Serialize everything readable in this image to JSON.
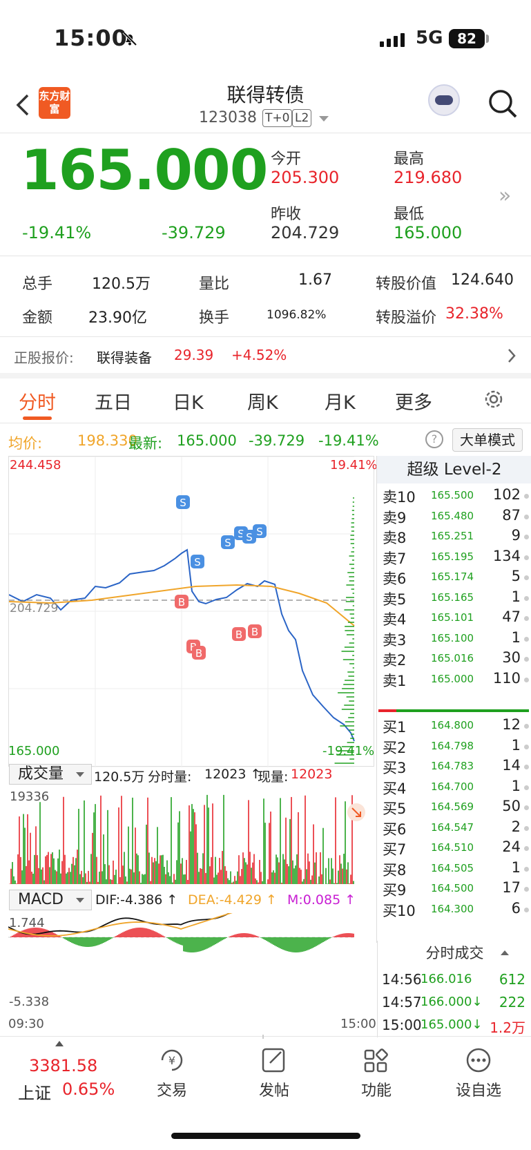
{
  "status_bar": {
    "time": "15:00",
    "network": "5G",
    "battery": "82"
  },
  "header": {
    "logo_text": "东方财富",
    "title": "联得转债",
    "code": "123038",
    "tag1": "T+0",
    "tag2": "L2"
  },
  "quote": {
    "price": "165.000",
    "change_pct": "-19.41%",
    "change": "-39.729",
    "open_label": "今开",
    "open": "205.300",
    "high_label": "最高",
    "high": "219.680",
    "prev_close_label": "昨收",
    "prev_close": "204.729",
    "low_label": "最低",
    "low": "165.000"
  },
  "stats": {
    "vol_label": "总手",
    "vol": "120.5万",
    "ratio_label": "量比",
    "ratio": "1.67",
    "conv_value_label": "转股价值",
    "conv_value": "124.640",
    "amount_label": "金额",
    "amount": "23.90亿",
    "turnover_label": "换手",
    "turnover": "1096.82%",
    "premium_label": "转股溢价",
    "premium": "32.38%"
  },
  "underlying": {
    "label": "正股报价:",
    "name": "联得装备",
    "price": "29.39",
    "change": "+4.52%"
  },
  "tabs": [
    "分时",
    "五日",
    "日K",
    "周K",
    "月K",
    "更多"
  ],
  "info_line": {
    "avg_label": "均价:",
    "avg": "198.330",
    "last_label": "最新:",
    "last": "165.000",
    "chg": "-39.729",
    "pct": "-19.41%",
    "mode_button": "大单模式"
  },
  "chart_labels": {
    "ymax": "244.458",
    "ymin": "165.000",
    "ref": "204.729",
    "pct_top": "19.41%",
    "pct_bottom": "-19.41%",
    "t_start": "09:30",
    "t_end": "15:00"
  },
  "volume_bar": {
    "selector": "成交量",
    "total": "120.5万",
    "minute_label": "分时量:",
    "minute": "12023 ↑",
    "now_label": "现量:",
    "now": "12023",
    "ymax": "19336"
  },
  "macd_bar": {
    "selector": "MACD",
    "dif": "DIF:-4.386 ↑",
    "dea": "DEA:-4.429 ↑",
    "m": "M:0.085 ↑",
    "top": "1.744",
    "bottom": "-5.338"
  },
  "orderbook": {
    "title": "超级 Level-2",
    "asks": [
      {
        "n": "卖10",
        "p": "165.500",
        "q": "102"
      },
      {
        "n": "卖9",
        "p": "165.480",
        "q": "87"
      },
      {
        "n": "卖8",
        "p": "165.251",
        "q": "9"
      },
      {
        "n": "卖7",
        "p": "165.195",
        "q": "134"
      },
      {
        "n": "卖6",
        "p": "165.174",
        "q": "5"
      },
      {
        "n": "卖5",
        "p": "165.165",
        "q": "1"
      },
      {
        "n": "卖4",
        "p": "165.101",
        "q": "47"
      },
      {
        "n": "卖3",
        "p": "165.100",
        "q": "1"
      },
      {
        "n": "卖2",
        "p": "165.016",
        "q": "30"
      },
      {
        "n": "卖1",
        "p": "165.000",
        "q": "110"
      }
    ],
    "bids": [
      {
        "n": "买1",
        "p": "164.800",
        "q": "12"
      },
      {
        "n": "买2",
        "p": "164.798",
        "q": "1"
      },
      {
        "n": "买3",
        "p": "164.783",
        "q": "14"
      },
      {
        "n": "买4",
        "p": "164.700",
        "q": "1"
      },
      {
        "n": "买5",
        "p": "164.569",
        "q": "50"
      },
      {
        "n": "买6",
        "p": "164.547",
        "q": "2"
      },
      {
        "n": "买7",
        "p": "164.510",
        "q": "24"
      },
      {
        "n": "买8",
        "p": "164.505",
        "q": "1"
      },
      {
        "n": "买9",
        "p": "164.500",
        "q": "17"
      },
      {
        "n": "买10",
        "p": "164.300",
        "q": "6"
      }
    ]
  },
  "trades": {
    "title": "分时成交",
    "rows": [
      {
        "t": "14:56",
        "p": "166.016",
        "q": "612"
      },
      {
        "t": "14:57",
        "p": "166.000↓",
        "q": "222"
      },
      {
        "t": "15:00",
        "p": "165.000↓",
        "q": "1.2万"
      }
    ]
  },
  "bottom": {
    "index_value": "3381.58",
    "index_name": "上证",
    "index_pct": "0.65%",
    "items": [
      "交易",
      "发帖",
      "功能",
      "设自选"
    ]
  },
  "colors": {
    "up": "#e8242b",
    "down": "#1fa01f",
    "accent": "#f05a23",
    "avg_line": "#f0a52a",
    "price_line": "#2a64c6"
  }
}
